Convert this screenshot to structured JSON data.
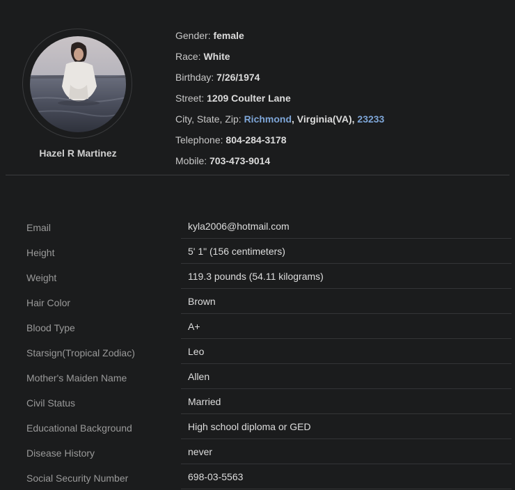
{
  "profile": {
    "name": "Hazel R Martinez",
    "details": [
      {
        "label": "Gender:",
        "value": "female"
      },
      {
        "label": "Race:",
        "value": "White"
      },
      {
        "label": "Birthday:",
        "value": "7/26/1974"
      },
      {
        "label": "Street:",
        "value": "1209 Coulter Lane"
      },
      {
        "label": "Telephone:",
        "value": "804-284-3178"
      },
      {
        "label": "Mobile:",
        "value": "703-473-9014"
      }
    ],
    "address": {
      "label": "City, State, Zip:",
      "city": "Richmond",
      "sep1": ",",
      "state": "Virginia(VA)",
      "sep2": ",",
      "zip": "23233"
    }
  },
  "info": [
    {
      "label": "Email",
      "value": "kyla2006@hotmail.com"
    },
    {
      "label": "Height",
      "value": "5' 1\" (156 centimeters)"
    },
    {
      "label": "Weight",
      "value": "119.3 pounds (54.11 kilograms)"
    },
    {
      "label": "Hair Color",
      "value": "Brown"
    },
    {
      "label": "Blood Type",
      "value": "A+"
    },
    {
      "label": "Starsign(Tropical Zodiac)",
      "value": "Leo"
    },
    {
      "label": "Mother's Maiden Name",
      "value": "Allen"
    },
    {
      "label": "Civil Status",
      "value": "Married"
    },
    {
      "label": "Educational Background",
      "value": "High school diploma or GED"
    },
    {
      "label": "Disease History",
      "value": "never"
    },
    {
      "label": "Social Security Number",
      "value": "698-03-5563"
    }
  ],
  "colors": {
    "background": "#1b1c1d",
    "link": "#7ea6d8",
    "label": "#9a9a9a",
    "value": "#dedede"
  }
}
